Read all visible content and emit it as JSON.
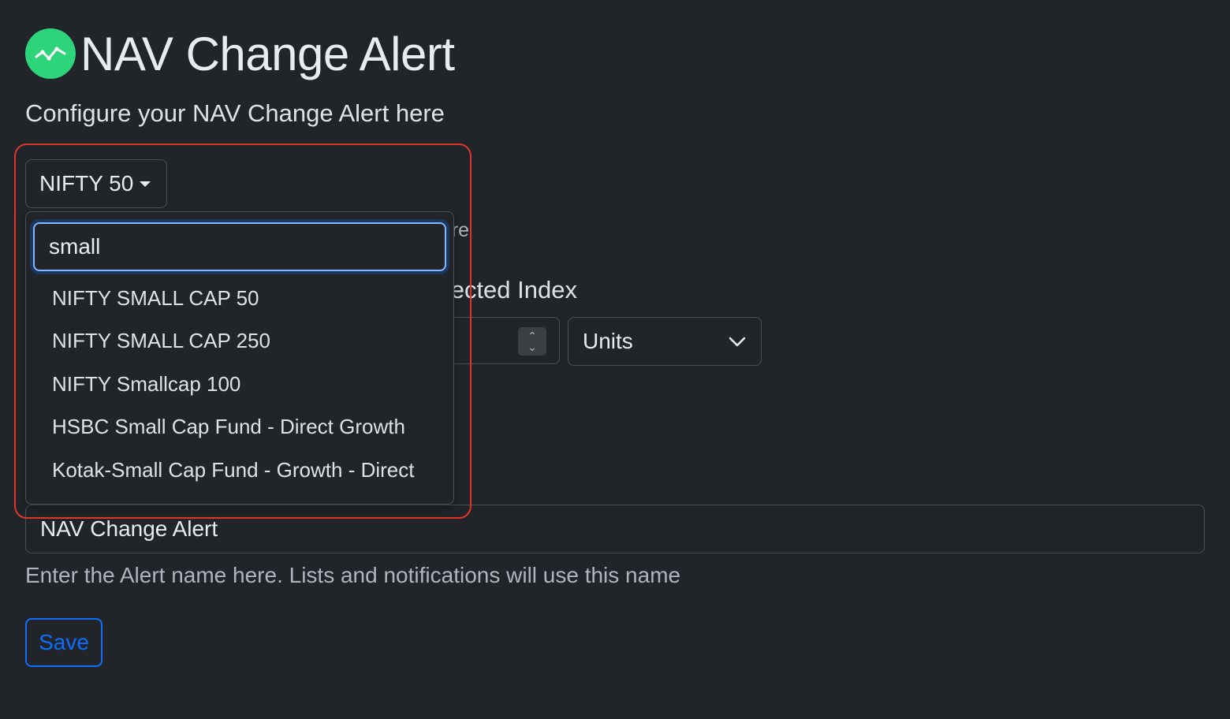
{
  "header": {
    "title": "NAV Change Alert",
    "subtitle": "Configure your NAV Change Alert here"
  },
  "index_dropdown": {
    "selected": "NIFTY 50",
    "search_value": "small",
    "options": [
      "NIFTY SMALL CAP 50",
      "NIFTY SMALL CAP 250",
      "NIFTY Smallcap 100",
      "HSBC Small Cap Fund - Direct Growth",
      "Kotak-Small Cap Fund - Growth - Direct"
    ]
  },
  "obscured": {
    "help_fragment": "re",
    "section_label_fragment": "ected Index"
  },
  "threshold": {
    "unit_selected": "Units"
  },
  "alert_name": {
    "value": "NAV Change Alert",
    "help": "Enter the Alert name here. Lists and notifications will use this name"
  },
  "actions": {
    "save_label": "Save"
  },
  "colors": {
    "background": "#212529",
    "logo": "#2ed47a",
    "primary": "#0d6efd",
    "highlight": "#e0352b"
  }
}
